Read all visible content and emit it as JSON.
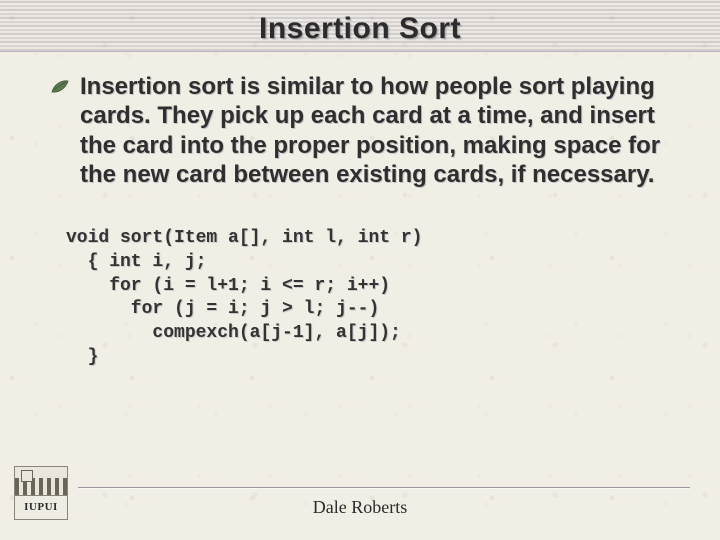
{
  "title": "Insertion Sort",
  "paragraph": "Insertion sort is similar to how people sort playing cards.  They pick up each card at a time, and insert the card into the proper position, making space for the new card between existing cards, if necessary.",
  "code_lines": [
    "void sort(Item a[], int l, int r)",
    "  { int i, j;",
    "    for (i = l+1; i <= r; i++)",
    "      for (j = i; j > l; j--)",
    "        compexch(a[j-1], a[j]);",
    "  }"
  ],
  "logo_text": "IUPUI",
  "footer_author": "Dale Roberts"
}
